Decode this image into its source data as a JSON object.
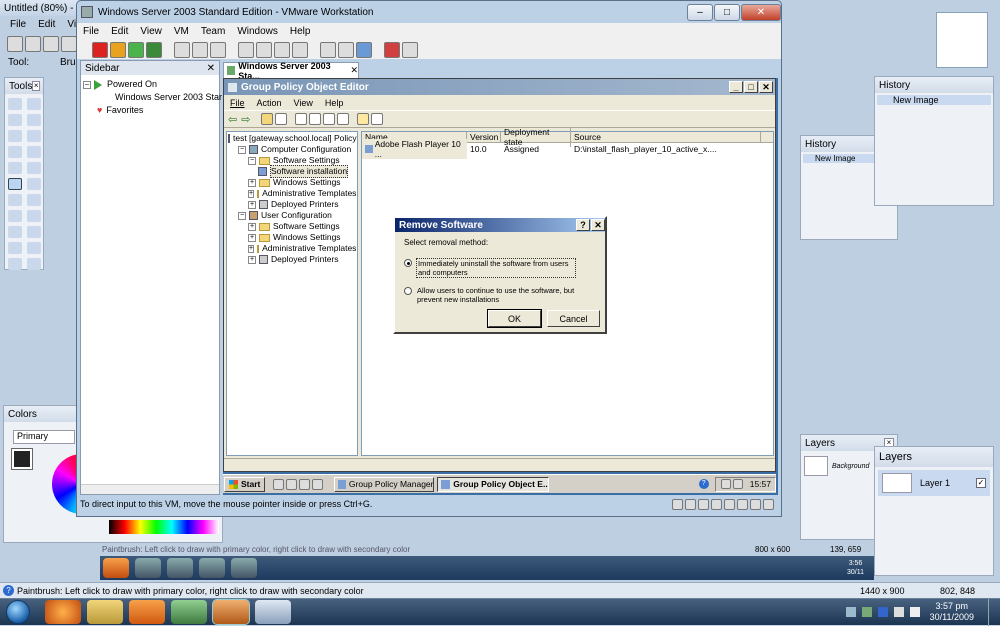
{
  "desktop": {
    "paint_title": "Untitled (80%) - ",
    "paint_menu": [
      "File",
      "Edit",
      "View"
    ],
    "tool_label": "Tool:",
    "brush_label": "Brus",
    "tools_title": "Tools",
    "colors_title": "Colors",
    "primary_select": "Primary",
    "history_title": "History",
    "history_item": "New Image",
    "layers_title": "Layers",
    "layer1": "Layer 1",
    "background_layer": "Background",
    "status_hint": "Paintbrush: Left click to draw with primary color, right click to draw with secondary color",
    "status_size": "1440 x 900",
    "status_coords": "802, 848",
    "inner_status_hint": "Paintbrush: Left click to draw with primary color, right click to draw with secondary color",
    "inner_status_size": "800 x 600",
    "inner_status_coords": "139, 659"
  },
  "vmware": {
    "title": "Windows Server 2003 Standard Edition - VMware Workstation",
    "menu": [
      "File",
      "Edit",
      "View",
      "VM",
      "Team",
      "Windows",
      "Help"
    ],
    "sidebar_title": "Sidebar",
    "powered_on": "Powered On",
    "vm_name": "Windows Server 2003 Star",
    "favorites": "Favorites",
    "tab_label": "Windows Server 2003 Sta...",
    "status": "To direct input to this VM, move the mouse pointer inside or press Ctrl+G."
  },
  "gpo": {
    "title": "Group Policy Object Editor",
    "menu": [
      "File",
      "Action",
      "View",
      "Help"
    ],
    "tree": [
      {
        "label": "test [gateway.school.local] Policy",
        "indent": 0,
        "kind": "root"
      },
      {
        "label": "Computer Configuration",
        "indent": 1,
        "kind": "pc"
      },
      {
        "label": "Software Settings",
        "indent": 2,
        "kind": "folder"
      },
      {
        "label": "Software installation",
        "indent": 3,
        "kind": "pkg",
        "selected": true
      },
      {
        "label": "Windows Settings",
        "indent": 2,
        "kind": "folder"
      },
      {
        "label": "Administrative Templates",
        "indent": 2,
        "kind": "folder"
      },
      {
        "label": "Deployed Printers",
        "indent": 2,
        "kind": "printer"
      },
      {
        "label": "User Configuration",
        "indent": 1,
        "kind": "user"
      },
      {
        "label": "Software Settings",
        "indent": 2,
        "kind": "folder"
      },
      {
        "label": "Windows Settings",
        "indent": 2,
        "kind": "folder"
      },
      {
        "label": "Administrative Templates",
        "indent": 2,
        "kind": "folder"
      },
      {
        "label": "Deployed Printers",
        "indent": 2,
        "kind": "printer"
      }
    ],
    "columns": [
      "Name",
      "Version",
      "Deployment state",
      "Source"
    ],
    "row": {
      "name": "Adobe Flash Player 10 ...",
      "version": "10.0",
      "state": "Assigned",
      "source": "D:\\install_flash_player_10_active_x...."
    }
  },
  "dialog": {
    "title": "Remove Software",
    "prompt": "Select removal method:",
    "option1": "Immediately uninstall the software from users and computers",
    "option2": "Allow users to continue to use the software, but prevent new installations",
    "ok": "OK",
    "cancel": "Cancel"
  },
  "guest_taskbar": {
    "start": "Start",
    "task1": "Group Policy Management",
    "task2": "Group Policy Object E...",
    "clock": "15:57"
  },
  "host_taskbar": {
    "time": "3:57 pm",
    "date": "30/11/2009",
    "inner_time": "3:56",
    "inner_date": "30/11"
  },
  "colors": {
    "accent": "#3a6ea5",
    "task_blue": "#1d3a5f"
  }
}
